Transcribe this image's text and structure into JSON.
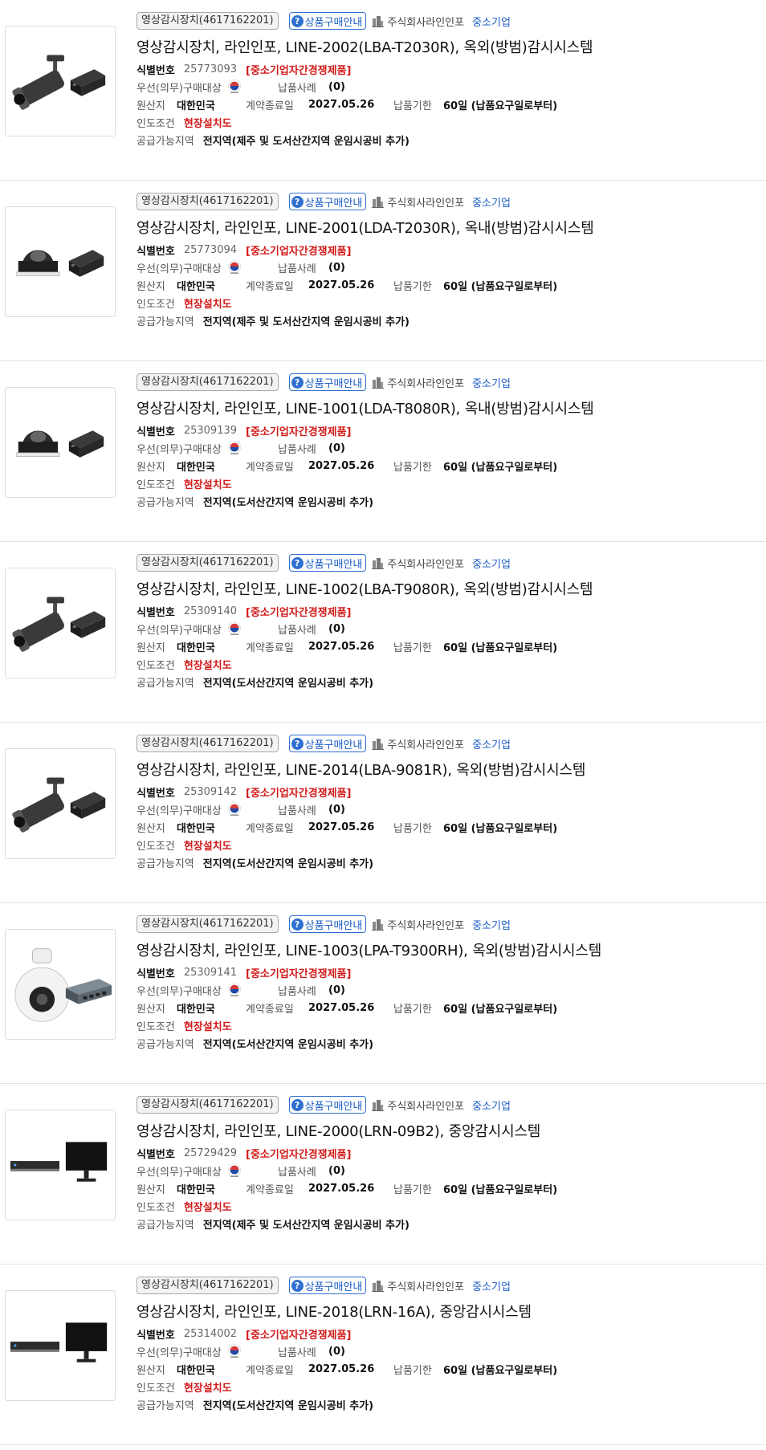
{
  "common": {
    "category": "영상감시장치(4617162201)",
    "guide_label": "상품구매안내",
    "guide_icon": "question-mark-icon",
    "company": "주식회사라인인포",
    "company_icon": "building-icon",
    "size_tag": "중소기업",
    "id_label": "식별번호",
    "competition_tag": "[중소기업자간경쟁제품]",
    "priority_label": "우선(의무)구매대상",
    "priority_icon": "korea-flag-icon",
    "cases_label": "납품사례",
    "cases_value": "(0)",
    "origin_label": "원산지",
    "origin_value": "대한민국",
    "contract_end_label": "계약종료일",
    "contract_end_value": "2027.05.26",
    "delivery_label": "납품기한",
    "delivery_value": "60일 (납품요구일로부터)",
    "handover_label": "인도조건",
    "handover_value": "현장설치도",
    "supply_label": "공급가능지역"
  },
  "colors": {
    "accent_blue": "#1a5bc4",
    "warning_red": "#d21a1a"
  },
  "items": [
    {
      "title": "영상감시장치, 라인인포, LINE-2002(LBA-T2030R), 옥외(방범)감시시스템",
      "id": "25773093",
      "supply": "전지역(제주 및 도서산간지역 운임시공비 추가)",
      "image": "bullet-camera-with-poe-injector"
    },
    {
      "title": "영상감시장치, 라인인포, LINE-2001(LDA-T2030R), 옥내(방범)감시시스템",
      "id": "25773094",
      "supply": "전지역(제주 및 도서산간지역 운임시공비 추가)",
      "image": "dome-camera-with-poe-injector"
    },
    {
      "title": "영상감시장치, 라인인포, LINE-1001(LDA-T8080R), 옥내(방범)감시시스템",
      "id": "25309139",
      "supply": "전지역(도서산간지역 운임시공비 추가)",
      "image": "dome-camera-with-poe-injector"
    },
    {
      "title": "영상감시장치, 라인인포, LINE-1002(LBA-T9080R), 옥외(방범)감시시스템",
      "id": "25309140",
      "supply": "전지역(도서산간지역 운임시공비 추가)",
      "image": "bullet-camera-with-poe-injector"
    },
    {
      "title": "영상감시장치, 라인인포, LINE-2014(LBA-9081R), 옥외(방범)감시시스템",
      "id": "25309142",
      "supply": "전지역(도서산간지역 운임시공비 추가)",
      "image": "bullet-camera-with-poe-injector"
    },
    {
      "title": "영상감시장치, 라인인포, LINE-1003(LPA-T9300RH), 옥외(방범)감시시스템",
      "id": "25309141",
      "supply": "전지역(도서산간지역 운임시공비 추가)",
      "image": "ptz-camera-with-network-switch"
    },
    {
      "title": "영상감시장치, 라인인포, LINE-2000(LRN-09B2), 중앙감시시스템",
      "id": "25729429",
      "supply": "전지역(제주 및 도서산간지역 운임시공비 추가)",
      "image": "recorder-with-monitor"
    },
    {
      "title": "영상감시장치, 라인인포, LINE-2018(LRN-16A), 중앙감시시스템",
      "id": "25314002",
      "supply": "전지역(도서산간지역 운임시공비 추가)",
      "image": "recorder-with-monitor"
    }
  ]
}
